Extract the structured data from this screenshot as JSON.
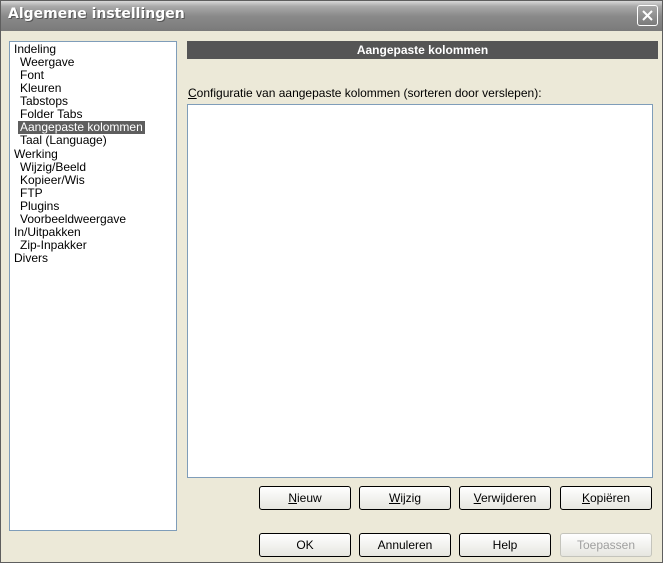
{
  "window": {
    "title": "Algemene instellingen"
  },
  "tree": {
    "items": [
      {
        "label": "Indeling",
        "level": 0
      },
      {
        "label": "Weergave",
        "level": 1
      },
      {
        "label": "Font",
        "level": 1
      },
      {
        "label": "Kleuren",
        "level": 1
      },
      {
        "label": "Tabstops",
        "level": 1
      },
      {
        "label": "Folder Tabs",
        "level": 1
      },
      {
        "label": "Aangepaste kolommen",
        "level": 1,
        "selected": true
      },
      {
        "label": "Taal (Language)",
        "level": 1
      },
      {
        "label": "Werking",
        "level": 0
      },
      {
        "label": "Wijzig/Beeld",
        "level": 1
      },
      {
        "label": "Kopieer/Wis",
        "level": 1
      },
      {
        "label": "FTP",
        "level": 1
      },
      {
        "label": "Plugins",
        "level": 1
      },
      {
        "label": "Voorbeeldweergave",
        "level": 1
      },
      {
        "label": "In/Uitpakken",
        "level": 0
      },
      {
        "label": "Zip-Inpakker",
        "level": 1
      },
      {
        "label": "Divers",
        "level": 0
      }
    ]
  },
  "panel": {
    "header": "Aangepaste kolommen",
    "config_label_first": "C",
    "config_label_rest": "onfiguratie van aangepaste kolommen (sorteren door verslepen):"
  },
  "actions": {
    "new_first": "N",
    "new_rest": "ieuw",
    "edit_first": "W",
    "edit_rest": "ijzig",
    "remove_first": "V",
    "remove_rest": "erwijderen",
    "copy_first": "K",
    "copy_rest": "opiëren"
  },
  "footer": {
    "ok": "OK",
    "cancel": "Annuleren",
    "help": "Help",
    "apply": "Toepassen"
  },
  "colors": {
    "title_bar": "#8a8a8a",
    "selection": "#5e5e5e",
    "panel_header": "#555555",
    "dialog_bg": "#ece9d8"
  },
  "icons": {
    "close": "close-icon"
  }
}
